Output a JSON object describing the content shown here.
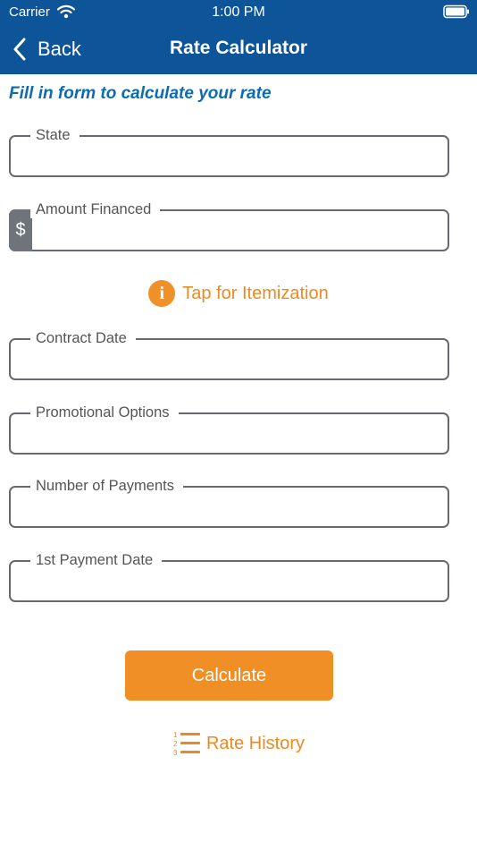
{
  "status_bar": {
    "carrier": "Carrier",
    "time": "1:00 PM",
    "wifi_icon": "wifi-icon",
    "battery_icon": "battery-icon"
  },
  "nav": {
    "back_label": "Back",
    "title": "Rate Calculator",
    "background_color": "#0d5499"
  },
  "subtitle": "Fill in form to calculate your rate",
  "fields": {
    "state": {
      "label": "State",
      "value": ""
    },
    "amount_financed": {
      "label": "Amount Financed",
      "prefix": "$",
      "value": ""
    },
    "contract_date": {
      "label": "Contract Date",
      "value": ""
    },
    "promotional_options": {
      "label": "Promotional Options",
      "value": ""
    },
    "number_of_payments": {
      "label": "Number of Payments",
      "value": ""
    },
    "first_payment_date": {
      "label": "1st Payment Date",
      "value": ""
    }
  },
  "itemization": {
    "icon": "info-icon",
    "label": "Tap for Itemization"
  },
  "calculate_button": {
    "label": "Calculate",
    "color": "#f08f26"
  },
  "rate_history": {
    "icon": "numbered-list-icon",
    "label": "Rate History"
  },
  "accent_color": "#ec8a22"
}
